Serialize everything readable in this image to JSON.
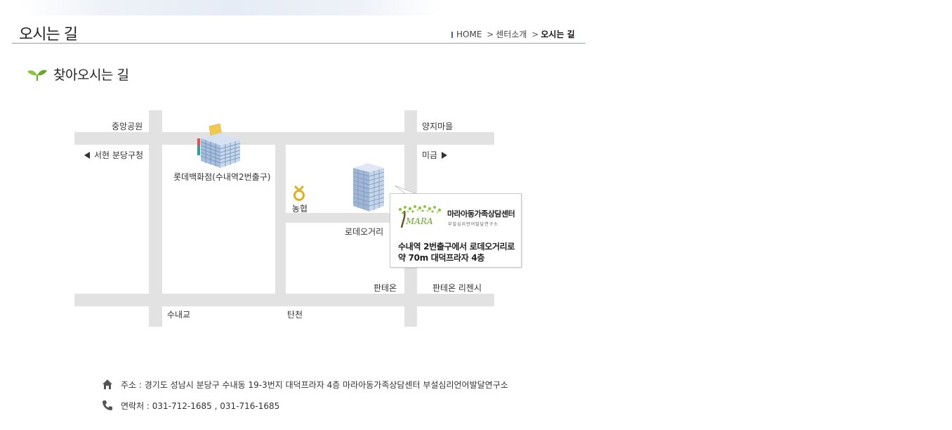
{
  "header": {
    "page_title": "오시는 길",
    "breadcrumb": {
      "home": "HOME",
      "separator": ">",
      "parent": "센터소개",
      "current": "오시는 길"
    }
  },
  "section": {
    "title": "찾아오시는 길",
    "icon": "sprout-icon"
  },
  "map": {
    "labels": {
      "jungang_park": "중앙공원",
      "yangji_village": "양지마을",
      "seohyeon_office": "서현 분당구청",
      "migeum": "미금",
      "lotte_dept": "롯데백화점(수내역2번출구)",
      "nonghyup": "농협",
      "rodeo_street": "로데오거리",
      "pantheon": "판테온",
      "pantheon_regency": "판테온 리젠시",
      "sunae_bridge": "수내교",
      "tancheon": "탄천"
    },
    "callout": {
      "logo_text": "MARA",
      "brand": "마라아동가족상담센터",
      "sub": "부설심리언어발달연구소",
      "directions_line1": "수내역 2번출구에서 로데오거리로",
      "directions_line2": "약 70m 대덕프라자 4층"
    },
    "colors": {
      "road": "#e2e2e2",
      "nonghyup": "#e0b020"
    }
  },
  "contact": {
    "address_icon": "home-icon",
    "address": "주소 : 경기도 성남시 분당구 수내동 19-3번지 대덕프라자 4층 마라아동가족상담센터 부설심리언어발달연구소",
    "phone_icon": "phone-icon",
    "phone": "연락처 : 031-712-1685 , 031-716-1685"
  }
}
